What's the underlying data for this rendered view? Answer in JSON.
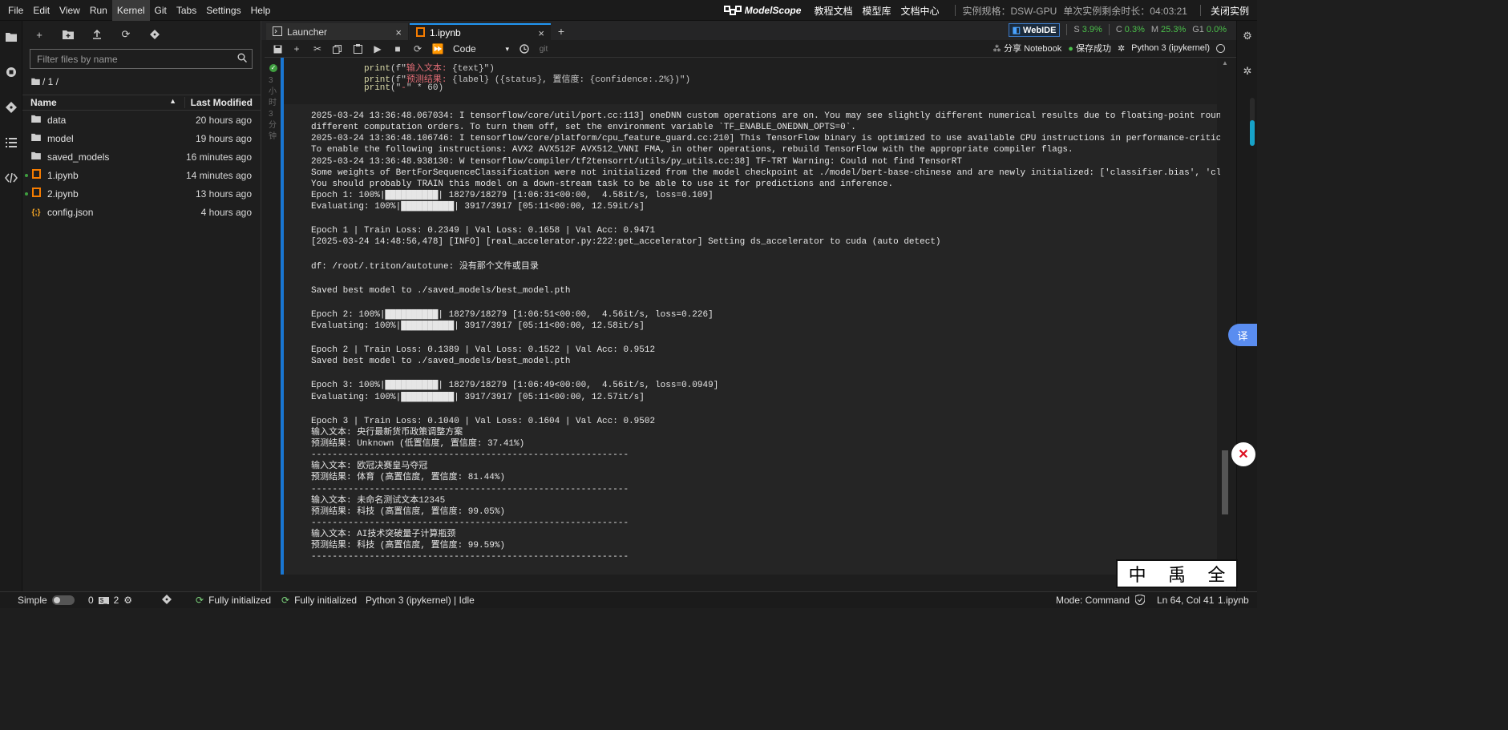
{
  "menu": [
    "File",
    "Edit",
    "View",
    "Run",
    "Kernel",
    "Git",
    "Tabs",
    "Settings",
    "Help"
  ],
  "menu_active": "Kernel",
  "topright": {
    "brand": "ModelScope",
    "links": [
      "教程文档",
      "模型库",
      "文档中心"
    ],
    "spec": "实例规格：DSW-GPU",
    "remaining": "单次实例剩余时长：04:03:21",
    "close": "关闭实例"
  },
  "filebrowser": {
    "search_placeholder": "Filter files by name",
    "breadcrumb": "/ 1 /",
    "col_name": "Name",
    "col_modified": "Last Modified",
    "files": [
      {
        "name": "data",
        "icon": "folder-icon",
        "modified": "20 hours ago",
        "running": false
      },
      {
        "name": "model",
        "icon": "folder-icon",
        "modified": "19 hours ago",
        "running": false
      },
      {
        "name": "saved_models",
        "icon": "folder-icon",
        "modified": "16 minutes ago",
        "running": false
      },
      {
        "name": "1.ipynb",
        "icon": "notebook-icon",
        "modified": "14 minutes ago",
        "running": true
      },
      {
        "name": "2.ipynb",
        "icon": "notebook-icon",
        "modified": "13 hours ago",
        "running": true
      },
      {
        "name": "config.json",
        "icon": "json-icon",
        "modified": "4 hours ago",
        "running": false
      }
    ]
  },
  "tabs": {
    "launcher": "Launcher",
    "notebook": "1.ipynb"
  },
  "webide": {
    "label": "WebIDE",
    "s_label": "S",
    "s_value": "3.9%",
    "c_label": "C",
    "c_value": "0.3%",
    "m_label": "M",
    "m_value": "25.3%",
    "g_label": "G1",
    "g_value": "0.0%"
  },
  "nbtoolbar": {
    "cell_type": "Code",
    "git": "git",
    "share": "分享 Notebook",
    "saved": "保存成功",
    "kernel": "Python 3 (ipykernel)"
  },
  "cell": {
    "exec_note": "3小时3分钟",
    "code_lines": [
      {
        "fn": "print",
        "pre": "(f\"",
        "str": "输入文本: ",
        "var": "{text}",
        "post": "\")"
      },
      {
        "fn": "print",
        "pre": "(f\"",
        "str": "预测结果: ",
        "var": "{label} ({status}, 置信度: {confidence:.2%})",
        "post": "\")"
      },
      {
        "fn": "print",
        "pre": "(\"",
        "str": "-",
        "var": "\" * 60",
        "post": ")"
      }
    ],
    "output": [
      "2025-03-24 13:36:48.067034: I tensorflow/core/util/port.cc:113] oneDNN custom operations are on. You may see slightly different numerical results due to floating-point round-off errors from",
      "different computation orders. To turn them off, set the environment variable `TF_ENABLE_ONEDNN_OPTS=0`.",
      "2025-03-24 13:36:48.106746: I tensorflow/core/platform/cpu_feature_guard.cc:210] This TensorFlow binary is optimized to use available CPU instructions in performance-critical operations.",
      "To enable the following instructions: AVX2 AVX512F AVX512_VNNI FMA, in other operations, rebuild TensorFlow with the appropriate compiler flags.",
      "2025-03-24 13:36:48.938130: W tensorflow/compiler/tf2tensorrt/utils/py_utils.cc:38] TF-TRT Warning: Could not find TensorRT",
      "Some weights of BertForSequenceClassification were not initialized from the model checkpoint at ./model/bert-base-chinese and are newly initialized: ['classifier.bias', 'classifier.weight']",
      "You should probably TRAIN this model on a down-stream task to be able to use it for predictions and inference.",
      "Epoch 1: 100%|██████████| 18279/18279 [1:06:31<00:00,  4.58it/s, loss=0.109]",
      "Evaluating: 100%|██████████| 3917/3917 [05:11<00:00, 12.59it/s]",
      "",
      "Epoch 1 | Train Loss: 0.2349 | Val Loss: 0.1658 | Val Acc: 0.9471",
      "[2025-03-24 14:48:56,478] [INFO] [real_accelerator.py:222:get_accelerator] Setting ds_accelerator to cuda (auto detect)",
      "",
      "df: /root/.triton/autotune: 没有那个文件或目录",
      "",
      "Saved best model to ./saved_models/best_model.pth",
      "",
      "Epoch 2: 100%|██████████| 18279/18279 [1:06:51<00:00,  4.56it/s, loss=0.226]",
      "Evaluating: 100%|██████████| 3917/3917 [05:11<00:00, 12.58it/s]",
      "",
      "Epoch 2 | Train Loss: 0.1389 | Val Loss: 0.1522 | Val Acc: 0.9512",
      "Saved best model to ./saved_models/best_model.pth",
      "",
      "Epoch 3: 100%|██████████| 18279/18279 [1:06:49<00:00,  4.56it/s, loss=0.0949]",
      "Evaluating: 100%|██████████| 3917/3917 [05:11<00:00, 12.57it/s]",
      "",
      "Epoch 3 | Train Loss: 0.1040 | Val Loss: 0.1604 | Val Acc: 0.9502",
      "输入文本: 央行最新货币政策调整方案",
      "预测结果: Unknown (低置信度, 置信度: 37.41%)",
      "------------------------------------------------------------",
      "输入文本: 欧冠决赛皇马夺冠",
      "预测结果: 体育 (高置信度, 置信度: 81.44%)",
      "------------------------------------------------------------",
      "输入文本: 未命名测试文本12345",
      "预测结果: 科技 (高置信度, 置信度: 99.05%)",
      "------------------------------------------------------------",
      "输入文本: AI技术突破量子计算瓶颈",
      "预测结果: 科技 (高置信度, 置信度: 99.59%)",
      "------------------------------------------------------------"
    ]
  },
  "rightpanel": {
    "translate": "译",
    "stamp": [
      "中",
      "禹",
      "全"
    ]
  },
  "statusbar": {
    "simple": "Simple",
    "count0": "0",
    "count2": "2",
    "init1": "Fully initialized",
    "init2": "Fully initialized",
    "kernel_status": "Python 3 (ipykernel) | Idle",
    "mode": "Mode: Command",
    "position": "Ln 64, Col 41",
    "file": "1.ipynb"
  }
}
